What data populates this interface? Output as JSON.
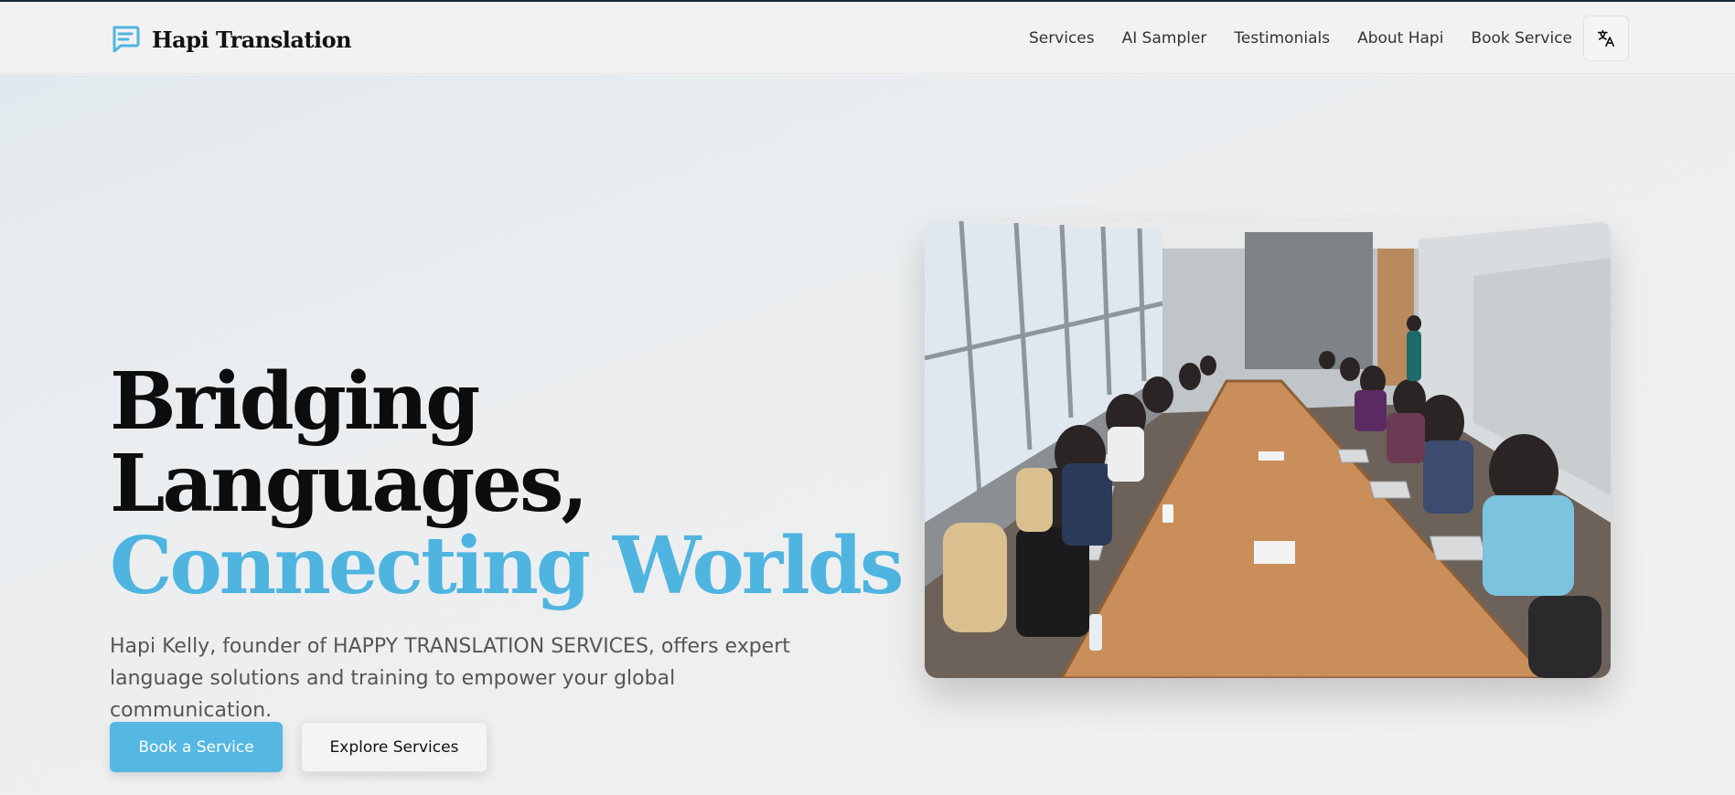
{
  "brand": {
    "name": "Hapi Translation",
    "logo_icon": "chat-bubble-icon"
  },
  "nav": {
    "links": [
      "Services",
      "AI Sampler",
      "Testimonials",
      "About Hapi",
      "Book Service"
    ],
    "language_icon": "translate-icon"
  },
  "hero": {
    "headline_line1": "Bridging",
    "headline_line2": "Languages,",
    "headline_accent": "Connecting Worlds",
    "subtitle": "Hapi Kelly, founder of HAPPY TRANSLATION SERVICES, offers expert language solutions and training to empower your global communication.",
    "primary_button": "Book a Service",
    "secondary_button": "Explore Services",
    "image_description_icon": "meeting-photo"
  },
  "colors": {
    "accent": "#4fb5e0",
    "button_primary": "#54b8e2",
    "text_dark": "#0d0d0d",
    "text_muted": "#555555"
  }
}
